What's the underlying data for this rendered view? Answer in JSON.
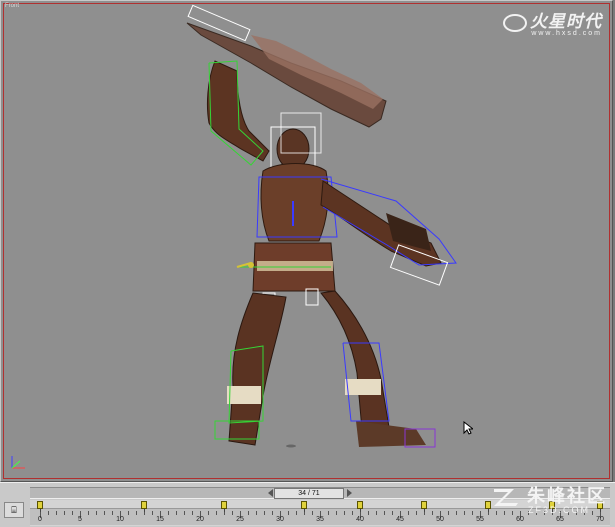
{
  "viewport": {
    "label": "Front",
    "background": "#8f8f8f",
    "active_border": "#b03030"
  },
  "watermark_top": {
    "title": "火星时代",
    "url": "www.hxsd.com"
  },
  "watermark_bottom": {
    "title": "朱峰社区",
    "url": "ZF3D.COM"
  },
  "scene": {
    "character": "barbarian-warrior",
    "weapon": "serrated-sword",
    "rig": "biped-bones"
  },
  "timeline": {
    "current_frame_label": "34 / 71",
    "current_frame": 34,
    "total_frames": 71,
    "tick_labels": [
      "0",
      "5",
      "10",
      "15",
      "20",
      "25",
      "30",
      "35",
      "40",
      "45",
      "50",
      "55",
      "60",
      "65",
      "70"
    ],
    "keyframes": [
      0,
      13,
      23,
      33,
      40,
      48,
      56,
      64,
      70
    ],
    "key_color": "#e0d23c"
  }
}
